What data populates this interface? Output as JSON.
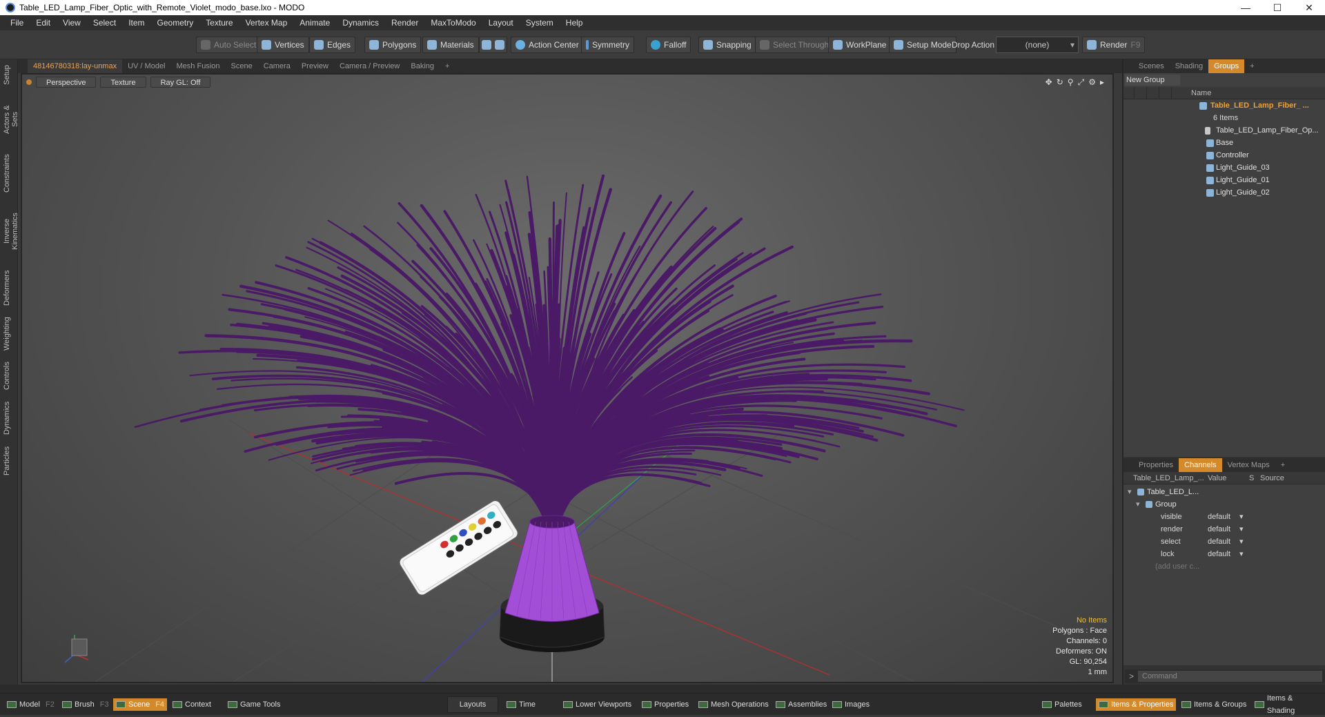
{
  "window": {
    "title": "Table_LED_Lamp_Fiber_Optic_with_Remote_Violet_modo_base.lxo - MODO",
    "controls": [
      "—",
      "☐",
      "✕"
    ]
  },
  "menu": [
    "File",
    "Edit",
    "View",
    "Select",
    "Item",
    "Geometry",
    "Texture",
    "Vertex Map",
    "Animate",
    "Dynamics",
    "Render",
    "MaxToModo",
    "Layout",
    "System",
    "Help"
  ],
  "toolbar": {
    "auto_select": "Auto Select",
    "vertices": "Vertices",
    "edges": "Edges",
    "polygons": "Polygons",
    "materials": "Materials",
    "action_center": "Action Center",
    "symmetry": "Symmetry",
    "falloff": "Falloff",
    "snapping": "Snapping",
    "select_through": "Select Through",
    "workplane": "WorkPlane",
    "setup_mode": "Setup Mode",
    "drop_action": "Drop Action",
    "drop_value": "(none)",
    "render": "Render",
    "render_key": "F9"
  },
  "left_tabs": [
    "Setup",
    "Actors & Sets",
    "Constraints",
    "Inverse Kinematics",
    "Deformers",
    "Weighting",
    "Controls",
    "Dynamics",
    "Particles"
  ],
  "viewport_tabs": [
    "48146780318:lay-unmax",
    "UV / Model",
    "Mesh Fusion",
    "Scene",
    "Camera",
    "Preview",
    "Camera / Preview",
    "Baking",
    "+"
  ],
  "viewport": {
    "view": "Perspective",
    "shading": "Texture",
    "raygl": "Ray GL: Off",
    "info": {
      "items": "No Items",
      "polygons": "Polygons : Face",
      "channels": "Channels: 0",
      "deformers": "Deformers: ON",
      "gl": "GL: 90,254",
      "unit": "1 mm"
    },
    "fiber_color": "#4a1a66",
    "base_color": "#a24ed6",
    "stand_color": "#111111"
  },
  "right_top_tabs": [
    "Scenes",
    "Shading",
    "Groups",
    "+"
  ],
  "groups": {
    "new_group": "New Group",
    "name_header": "Name",
    "root_label": "Table_LED_Lamp_Fiber_ ...",
    "root_count": "6 Items",
    "children": [
      "Table_LED_Lamp_Fiber_Op...",
      "Base",
      "Controller",
      "Light_Guide_03",
      "Light_Guide_01",
      "Light_Guide_02"
    ]
  },
  "right_mid_tabs": [
    "Properties",
    "Channels",
    "Vertex Maps",
    "+"
  ],
  "channels": {
    "col_item": "Table_LED_Lamp_...",
    "col_value": "Value",
    "col_s": "S",
    "col_source": "Source",
    "item": "Table_LED_L...",
    "group": "Group",
    "rows": [
      {
        "name": "visible",
        "value": "default"
      },
      {
        "name": "render",
        "value": "default"
      },
      {
        "name": "select",
        "value": "default"
      },
      {
        "name": "lock",
        "value": "default"
      }
    ],
    "add_user": "(add user c..."
  },
  "command": {
    "prompt": ">",
    "placeholder": "Command"
  },
  "bottom": {
    "model": "Model",
    "model_key": "F2",
    "brush": "Brush",
    "brush_key": "F3",
    "scene": "Scene",
    "scene_key": "F4",
    "context": "Context",
    "game_tools": "Game Tools",
    "layouts": "Layouts",
    "time": "Time",
    "lower_viewports": "Lower Viewports",
    "properties": "Properties",
    "mesh_operations": "Mesh Operations",
    "assemblies": "Assemblies",
    "images": "Images",
    "palettes": "Palettes",
    "items_properties": "Items & Properties",
    "items_groups": "Items & Groups",
    "items_shading": "Items & Shading"
  }
}
